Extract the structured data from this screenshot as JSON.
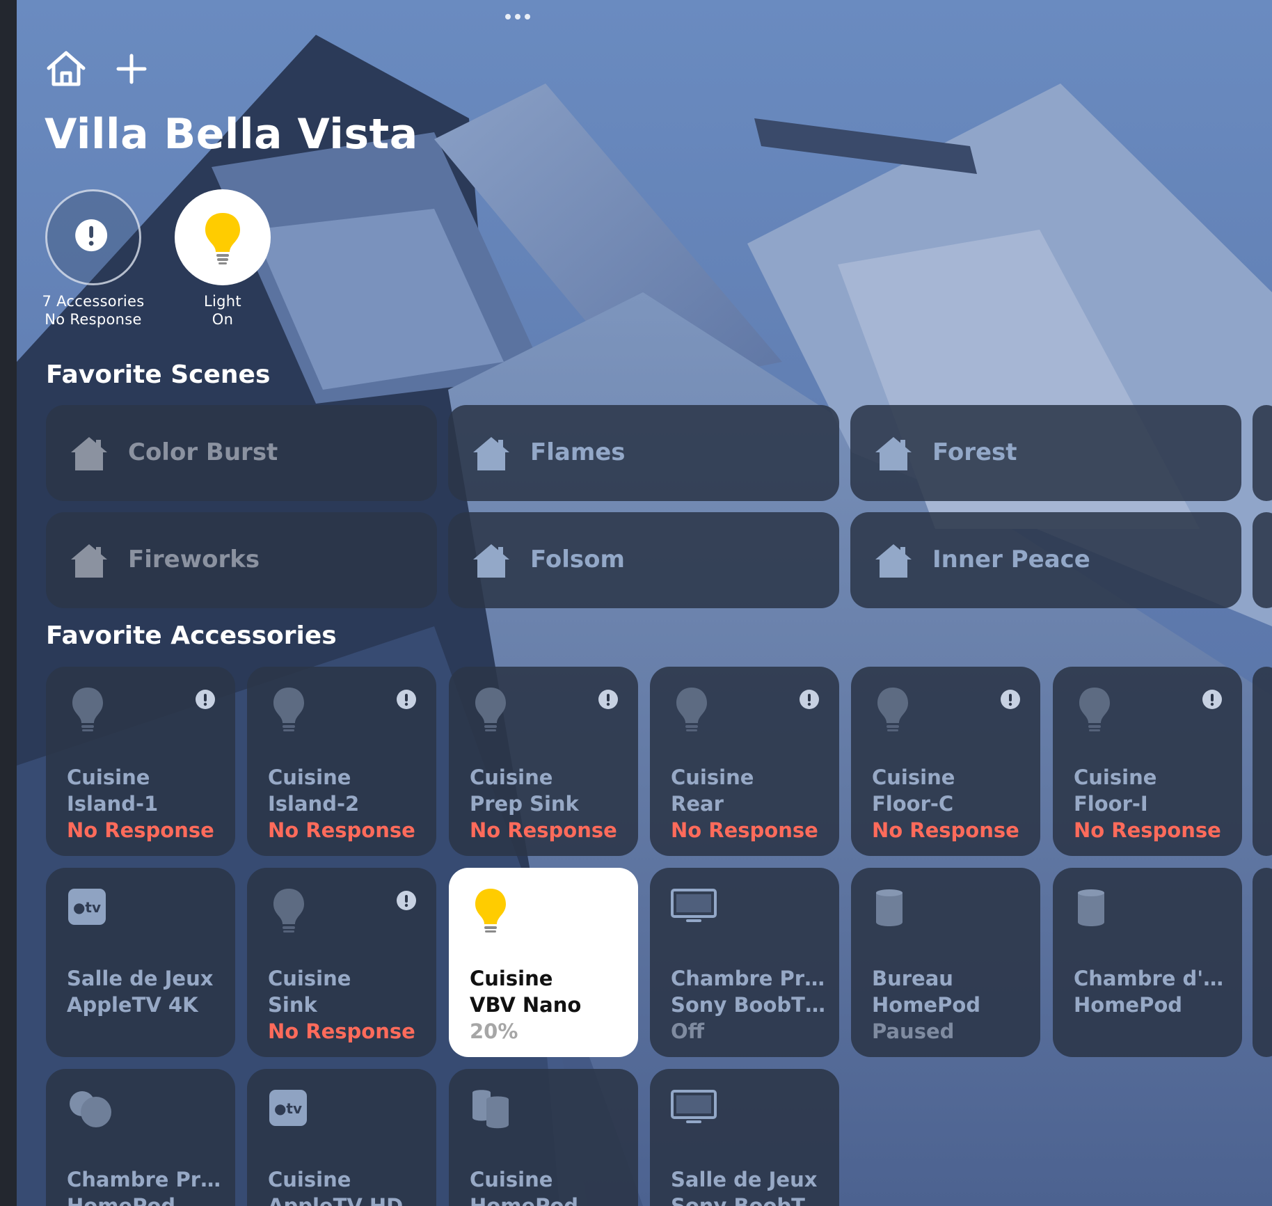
{
  "home": {
    "title": "Villa Bella Vista",
    "home_icon": "house-outline-icon",
    "add_icon": "plus-icon"
  },
  "status": [
    {
      "line1": "7 Accessories",
      "line2": "No Response",
      "icon": "exclamation-icon"
    },
    {
      "line1": "Light",
      "line2": "On",
      "icon": "light-bulb-icon"
    }
  ],
  "sections": {
    "scenes": "Favorite Scenes",
    "accessories": "Favorite Accessories"
  },
  "scenes": [
    {
      "label": "Color Burst",
      "icon": "house-scene-icon"
    },
    {
      "label": "Flames",
      "icon": "house-scene-icon"
    },
    {
      "label": "Forest",
      "icon": "house-scene-icon"
    },
    {
      "label": "Fireworks",
      "icon": "house-scene-icon"
    },
    {
      "label": "Folsom",
      "icon": "house-scene-icon"
    },
    {
      "label": "Inner Peace",
      "icon": "house-scene-icon"
    }
  ],
  "accessories": [
    {
      "room": "Cuisine",
      "name": "Island-1",
      "status": "No Response",
      "icon": "light-bulb-icon"
    },
    {
      "room": "Cuisine",
      "name": "Island-2",
      "status": "No Response",
      "icon": "light-bulb-icon"
    },
    {
      "room": "Cuisine",
      "name": "Prep Sink",
      "status": "No Response",
      "icon": "light-bulb-icon"
    },
    {
      "room": "Cuisine",
      "name": "Rear",
      "status": "No Response",
      "icon": "light-bulb-icon"
    },
    {
      "room": "Cuisine",
      "name": "Floor-C",
      "status": "No Response",
      "icon": "light-bulb-icon"
    },
    {
      "room": "Cuisine",
      "name": "Floor-I",
      "status": "No Response",
      "icon": "light-bulb-icon"
    },
    {
      "room": "Salle de Jeux",
      "name": "AppleTV 4K",
      "status": "",
      "icon": "apple-tv-icon"
    },
    {
      "room": "Cuisine",
      "name": "Sink",
      "status": "No Response",
      "icon": "light-bulb-icon"
    },
    {
      "room": "Cuisine",
      "name": "VBV Nano",
      "status": "20%",
      "icon": "light-bulb-icon"
    },
    {
      "room": "Chambre Pr…",
      "name": "Sony BoobT…",
      "status": "Off",
      "icon": "television-icon"
    },
    {
      "room": "Bureau",
      "name": "HomePod",
      "status": "Paused",
      "icon": "homepod-icon"
    },
    {
      "room": "Chambre d'…",
      "name": "HomePod",
      "status": "",
      "icon": "homepod-icon"
    },
    {
      "room": "Chambre Pr…",
      "name": "HomePod",
      "status": "",
      "icon": "homepod-mini-icon"
    },
    {
      "room": "Cuisine",
      "name": "AppleTV HD",
      "status": "",
      "icon": "apple-tv-icon"
    },
    {
      "room": "Cuisine",
      "name": "HomePod",
      "status": "",
      "icon": "homepod-pair-icon"
    },
    {
      "room": "Salle de Jeux",
      "name": "Sony BoobT…",
      "status": "",
      "icon": "television-icon"
    }
  ],
  "colors": {
    "tile_bg": "#2b3548",
    "scene_label": "#93a8c8",
    "accessory_label": "#97a9c6",
    "no_response": "#ff6b5b",
    "bulb_on": "#ffcc00",
    "bulb_off": "#5d6b82"
  }
}
